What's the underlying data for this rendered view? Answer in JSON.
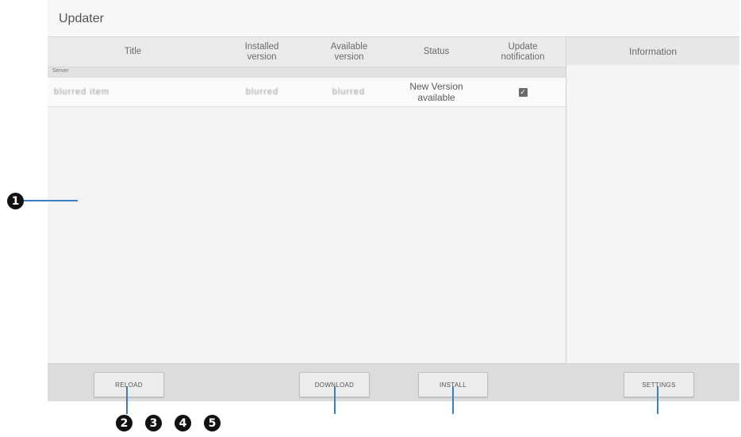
{
  "window": {
    "title": "Updater"
  },
  "table": {
    "headers": [
      "Title",
      "Installed\nversion",
      "Available\nversion",
      "Status",
      "Update\nnotification"
    ],
    "group_label": "Server",
    "rows": [
      {
        "title": "blurred item",
        "installed": "blurred",
        "available": "blurred",
        "status": "New Version\navailable",
        "notify_checked": true
      }
    ]
  },
  "info_pane": {
    "header": "Information"
  },
  "buttons": {
    "reload": "RELOAD",
    "download": "DOWNLOAD",
    "install": "INSTALL",
    "settings": "SETTINGS"
  },
  "callouts": {
    "one": "1",
    "two": "2",
    "three": "3",
    "four": "4",
    "five": "5"
  },
  "colors": {
    "callout_line": "#3b7dbf",
    "badge": "#111111",
    "checkbox": "#6a6a6a"
  }
}
